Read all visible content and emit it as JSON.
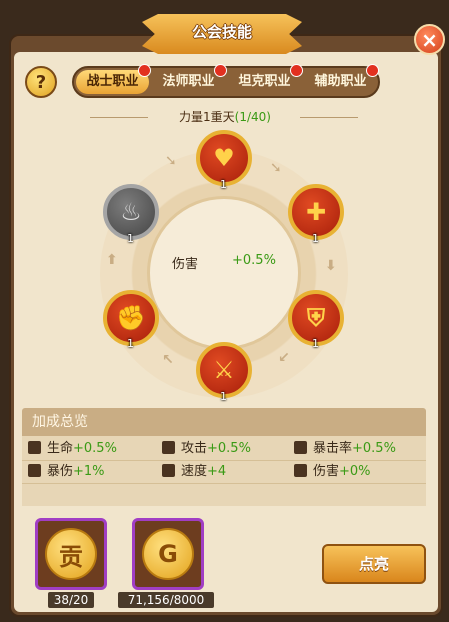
{
  "window": {
    "title": "公会技能"
  },
  "tabs": [
    {
      "label": "战士职业",
      "active": true
    },
    {
      "label": "法师职业",
      "active": false
    },
    {
      "label": "坦克职业",
      "active": false
    },
    {
      "label": "辅助职业",
      "active": false
    }
  ],
  "skill_tree": {
    "level_name": "力量1重天",
    "level_progress": "(1/40)",
    "center_label": "伤害",
    "center_value": "+0.5%",
    "skills": [
      {
        "icon": "heart-plus-icon",
        "level": "1",
        "locked": false
      },
      {
        "icon": "boot-plus-icon",
        "level": "1",
        "locked": false
      },
      {
        "icon": "shield-icon",
        "level": "1",
        "locked": false
      },
      {
        "icon": "sword-icon",
        "level": "1",
        "locked": false
      },
      {
        "icon": "fist-icon",
        "level": "1",
        "locked": false
      },
      {
        "icon": "flame-icon",
        "level": "1",
        "locked": true
      }
    ]
  },
  "stats": {
    "title": "加成总览",
    "rows": [
      [
        {
          "icon": "life-icon",
          "label": "生命",
          "value": "+0.5%"
        },
        {
          "icon": "attack-icon",
          "label": "攻击",
          "value": "+0.5%"
        },
        {
          "icon": "crit-rate-icon",
          "label": "暴击率",
          "value": "+0.5%"
        }
      ],
      [
        {
          "icon": "crit-damage-icon",
          "label": "暴伤",
          "value": "+1%"
        },
        {
          "icon": "speed-icon",
          "label": "速度",
          "value": "+4"
        },
        {
          "icon": "damage-icon",
          "label": "伤害",
          "value": "+0%"
        }
      ]
    ]
  },
  "resources": [
    {
      "icon": "contribution-coin-icon",
      "glyph": "贡",
      "count": "38/20"
    },
    {
      "icon": "gold-coin-icon",
      "glyph": "G",
      "count": "71,156/8000"
    }
  ],
  "actions": {
    "light_up": "点亮"
  },
  "icons": {
    "help": "?",
    "close": "×"
  },
  "colors": {
    "accent": "#e9a334",
    "bonus_green": "#3a9a15",
    "frame": "#6b4a2d"
  }
}
